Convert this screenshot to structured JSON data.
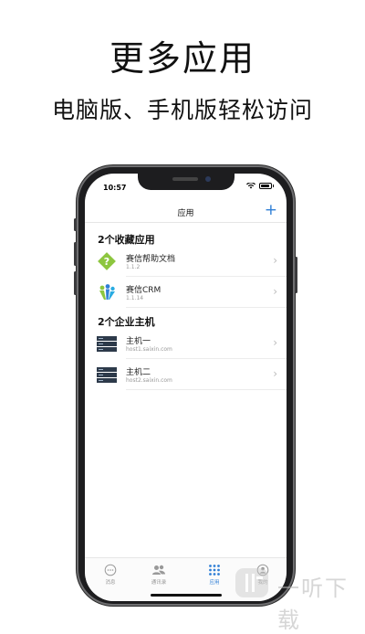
{
  "promo": {
    "headline": "更多应用",
    "subline": "电脑版、手机版轻松访问"
  },
  "status_bar": {
    "time": "10:57"
  },
  "nav": {
    "title": "应用",
    "add_icon": "plus-icon"
  },
  "favorites": {
    "title": "2个收藏应用",
    "items": [
      {
        "name": "赛信帮助文档",
        "version": "1.1.2",
        "icon": "help-doc-icon"
      },
      {
        "name": "赛信CRM",
        "version": "1.1.14",
        "icon": "crm-icon"
      }
    ]
  },
  "hosts": {
    "title": "2个企业主机",
    "items": [
      {
        "name": "主机一",
        "address": "host1.saixin.com",
        "icon": "server-icon"
      },
      {
        "name": "主机二",
        "address": "host2.saixin.com",
        "icon": "server-icon"
      }
    ]
  },
  "tabs": [
    {
      "label": "消息",
      "icon": "chat-icon",
      "active": false
    },
    {
      "label": "通讯录",
      "icon": "contacts-icon",
      "active": false
    },
    {
      "label": "应用",
      "icon": "apps-grid-icon",
      "active": true
    },
    {
      "label": "我的",
      "icon": "profile-icon",
      "active": false
    }
  ],
  "colors": {
    "accent": "#2f7fd6"
  },
  "watermark": {
    "text": "一听下载"
  }
}
